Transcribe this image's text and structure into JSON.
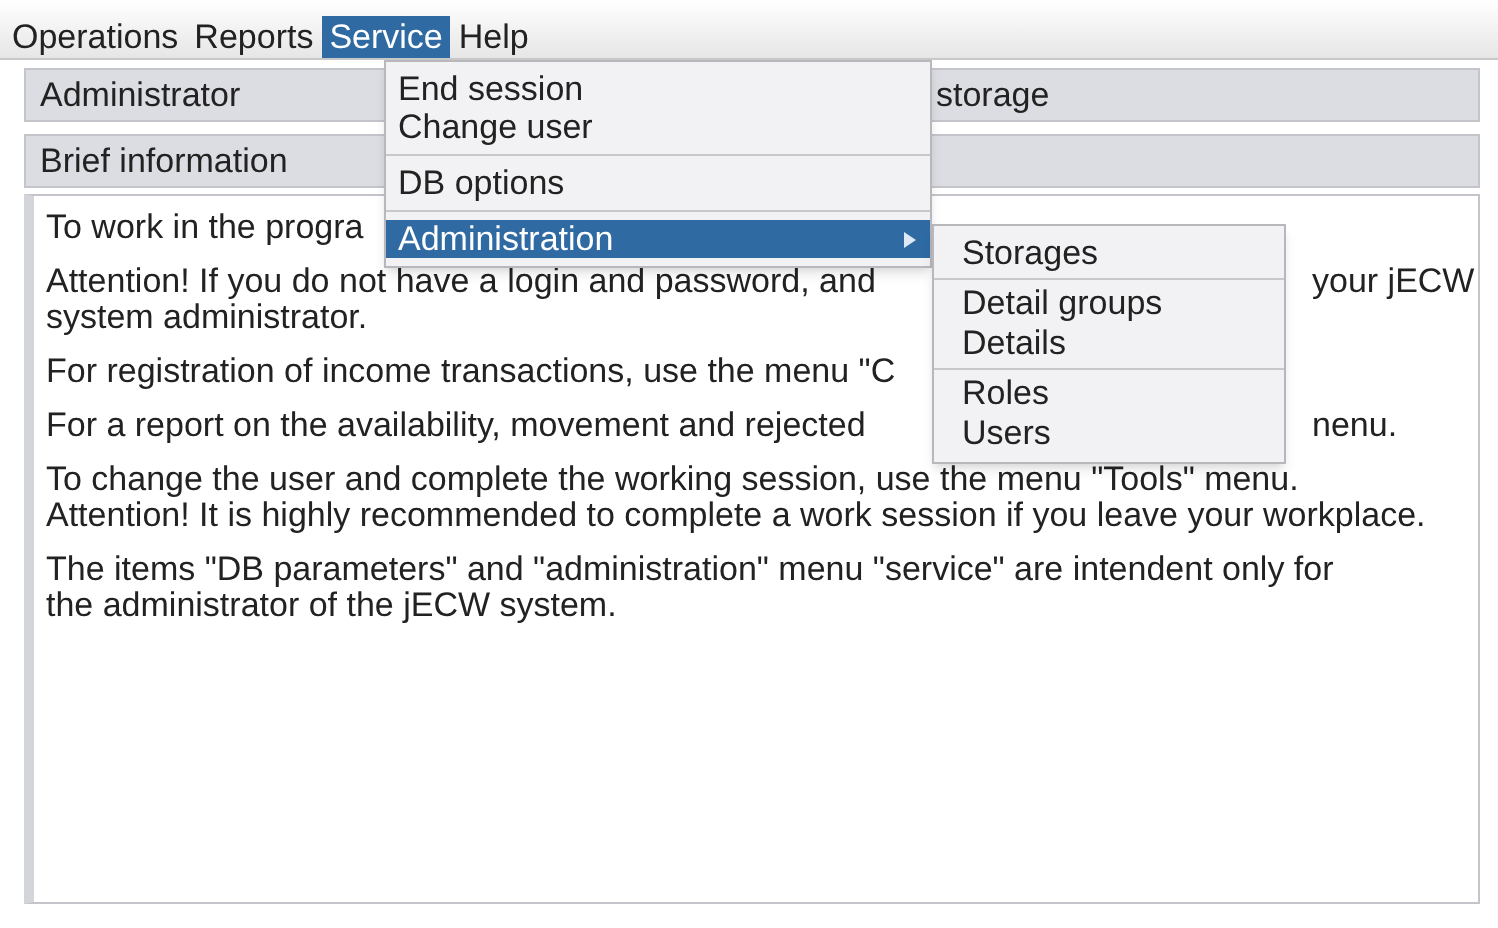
{
  "menu_bar": [
    {
      "label": "Operations",
      "selected": false
    },
    {
      "label": "Reports",
      "selected": false
    },
    {
      "label": "Service",
      "selected": true
    },
    {
      "label": "Help",
      "selected": false
    }
  ],
  "header_rows": [
    {
      "left": "Administrator",
      "right": "storage"
    },
    {
      "left": "Brief information"
    }
  ],
  "info_paragraphs": [
    {
      "lines": [
        {
          "left": "To work in the progra"
        }
      ]
    },
    {
      "lines": [
        {
          "left": "Attention! If you do not have a login and password, and",
          "right": "your jECW"
        },
        {
          "left": "system administrator."
        }
      ]
    },
    {
      "lines": [
        {
          "left": "For registration of income transactions, use the menu \"C"
        }
      ]
    },
    {
      "lines": [
        {
          "left": "For a report on the availability, movement and rejected",
          "right": "nenu."
        }
      ]
    },
    {
      "lines": [
        {
          "left": "To change the user and complete the working session, use the menu \"Tools\" menu."
        },
        {
          "left": "Attention! It is highly recommended to complete a work session if you leave your workplace."
        }
      ]
    },
    {
      "lines": [
        {
          "left": "The items \"DB parameters\" and \"administration\" menu \"service\" are intendent only for"
        },
        {
          "left": "the administrator of the jECW system."
        }
      ]
    }
  ],
  "service_menu": [
    {
      "items": [
        {
          "label": "End session",
          "kind": "command",
          "selected": false
        },
        {
          "label": "Change user",
          "kind": "command",
          "selected": false
        }
      ]
    },
    {
      "items": [
        {
          "label": "DB options",
          "kind": "command",
          "selected": false
        }
      ]
    },
    {
      "items": [
        {
          "label": "Administration",
          "kind": "submenu",
          "selected": true
        }
      ]
    }
  ],
  "administration_submenu": [
    {
      "items": [
        {
          "label": "Storages"
        }
      ]
    },
    {
      "items": [
        {
          "label": "Detail groups"
        },
        {
          "label": "Details"
        }
      ]
    },
    {
      "items": [
        {
          "label": "Roles"
        },
        {
          "label": "Users"
        }
      ]
    }
  ]
}
